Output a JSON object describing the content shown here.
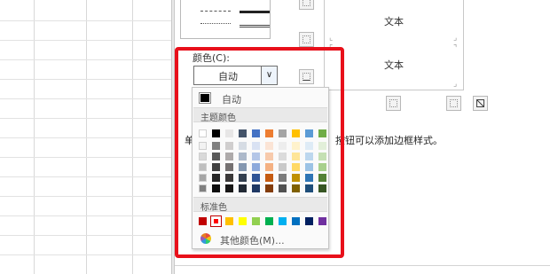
{
  "dialog": {
    "color_label": "颜色(C):",
    "color_value": "自动",
    "dropdown_icon": "chevron-down-icon",
    "preview_text_top": "文本",
    "preview_text_bottom": "文本",
    "hint_left": "单",
    "hint_right": "按钮可以添加边框样式。"
  },
  "color_menu": {
    "auto_label": "自动",
    "theme_section": "主题颜色",
    "standard_section": "标准色",
    "more_label": "其他颜色(M)...",
    "theme_colors": [
      [
        "#ffffff",
        "#f2f2f2",
        "#d9d9d9",
        "#bfbfbf",
        "#a6a6a6",
        "#808080"
      ],
      [
        "#000000",
        "#7f7f7f",
        "#595959",
        "#404040",
        "#262626",
        "#0d0d0d"
      ],
      [
        "#e7e6e6",
        "#d0cece",
        "#aeaaaa",
        "#757171",
        "#3a3838",
        "#171616"
      ],
      [
        "#44546a",
        "#d6dce4",
        "#adb9ca",
        "#8497b0",
        "#333f4f",
        "#222a35"
      ],
      [
        "#4472c4",
        "#d9e2f3",
        "#b4c6e7",
        "#8eaadb",
        "#2f5496",
        "#1f3864"
      ],
      [
        "#ed7d31",
        "#fbe4d5",
        "#f7caac",
        "#f4b183",
        "#c55a11",
        "#833c0b"
      ],
      [
        "#a5a5a5",
        "#ededed",
        "#dbdbdb",
        "#c9c9c9",
        "#7b7b7b",
        "#525252"
      ],
      [
        "#ffc000",
        "#fff2cc",
        "#fee599",
        "#ffd965",
        "#bf9000",
        "#7f6000"
      ],
      [
        "#5b9bd5",
        "#deebf6",
        "#bdd7ee",
        "#9cc3e5",
        "#2e75b5",
        "#1e4e79"
      ],
      [
        "#70ad47",
        "#e2efd9",
        "#c5e0b3",
        "#a8d08d",
        "#538135",
        "#375623"
      ]
    ],
    "standard_colors": [
      "#c00000",
      "#ff0000",
      "#ffc000",
      "#ffff00",
      "#92d050",
      "#00b050",
      "#00b0f0",
      "#0070c0",
      "#002060",
      "#7030a0"
    ],
    "selected_standard_index": 1
  },
  "colors": {
    "annotation_border": "#e8101a",
    "selected_swatch_outline": "#c00000"
  }
}
